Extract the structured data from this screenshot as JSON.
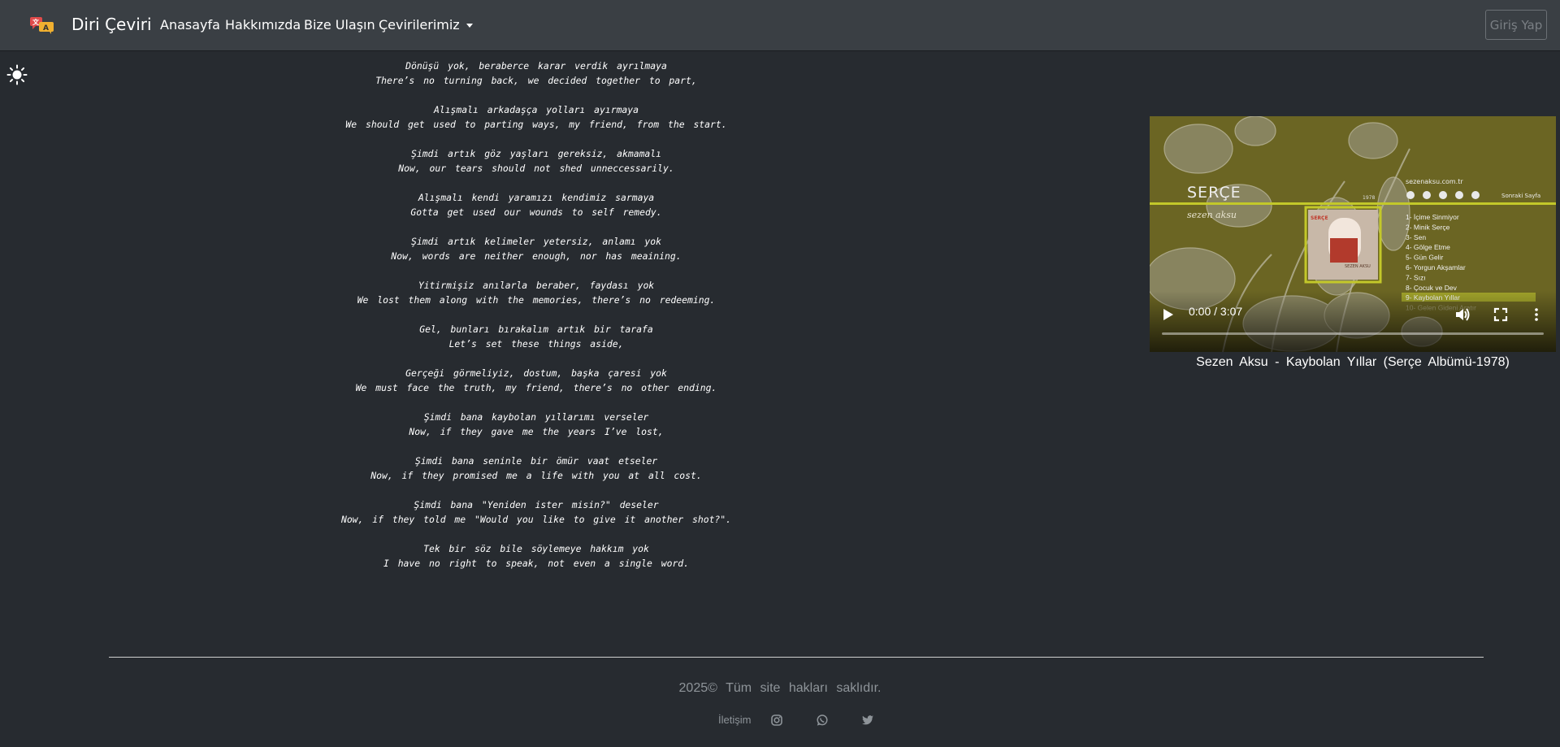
{
  "brand": {
    "name": "Diri Çeviri",
    "logo_icon": "translate-logo-icon"
  },
  "nav": {
    "links": [
      "Anasayfa",
      "Hakkımızda",
      "Bize Ulaşın",
      "Çevirilerimiz"
    ],
    "login_label": "Giriş Yap"
  },
  "theme_toggle_icon": "sun-icon",
  "lyrics": [
    {
      "tr": "Dönüşü yok, beraberce karar verdik ayrılmaya",
      "en": "There’s no turning back, we decided together to part,"
    },
    {
      "tr": "Alışmalı arkadaşça yolları ayırmaya",
      "en": "We should get used to parting ways, my friend, from the start."
    },
    {
      "tr": "Şimdi artık göz yaşları gereksiz, akmamalı",
      "en": "Now, our tears should not shed unneccessarily."
    },
    {
      "tr": "Alışmalı kendi yaramızı kendimiz sarmaya",
      "en": "Gotta get used our wounds to self remedy."
    },
    {
      "tr": "Şimdi artık kelimeler yetersiz, anlamı yok",
      "en": "Now, words are neither enough, nor has meaining."
    },
    {
      "tr": "Yitirmişiz anılarla beraber, faydası yok",
      "en": "We lost them along with the memories, there’s no redeeming."
    },
    {
      "tr": "Gel, bunları bırakalım artık bir tarafa",
      "en": "Let’s set these things aside,"
    },
    {
      "tr": "Gerçeği görmeliyiz, dostum, başka çaresi yok",
      "en": "We must face the truth, my friend, there’s no other ending."
    },
    {
      "tr": "Şimdi bana kaybolan yıllarımı verseler",
      "en": "Now, if they gave me the years I’ve lost,"
    },
    {
      "tr": "Şimdi bana seninle bir ömür vaat etseler",
      "en": "Now, if they promised me a life with you at all cost."
    },
    {
      "tr": "Şimdi bana \"Yeniden ister misin?\" deseler",
      "en": "Now, if they told me \"Would you like to give it another shot?\"."
    },
    {
      "tr": "Tek bir söz bile söylemeye hakkım yok",
      "en": "I have no right to speak, not even a single word."
    }
  ],
  "video": {
    "album_title": "SERÇE",
    "artist_script": "sezen aksu",
    "year": "1978",
    "website": "sezenaksu.com.tr",
    "next_page": "Sonraki Sayfa",
    "cover_label": "SEZEN AKSU",
    "tracklist": [
      "1- İçime Sinmiyor",
      "2- Minik Serçe",
      "3- Sen",
      "4- Gölge Etme",
      "5- Gün Gelir",
      "6- Yorgun Akşamlar",
      "7- Sızı",
      "8- Çocuk ve Dev",
      "9- Kaybolan Yıllar",
      "10- Gelen Gideni Aratır"
    ],
    "time": "0:00 / 3:07",
    "progress": 0,
    "caption": "Sezen Aksu - Kaybolan Yıllar (Serçe Albümü-1978)"
  },
  "footer": {
    "copyright": "2025© Tüm site hakları saklıdır.",
    "contact_label": "İletişim",
    "social_icons": [
      "instagram-icon",
      "whatsapp-icon",
      "twitter-icon"
    ]
  },
  "colors": {
    "background": "#272b30",
    "navbar": "#3a3f44",
    "video_olive": "#6b6523",
    "accent_line": "#c3c82a"
  }
}
